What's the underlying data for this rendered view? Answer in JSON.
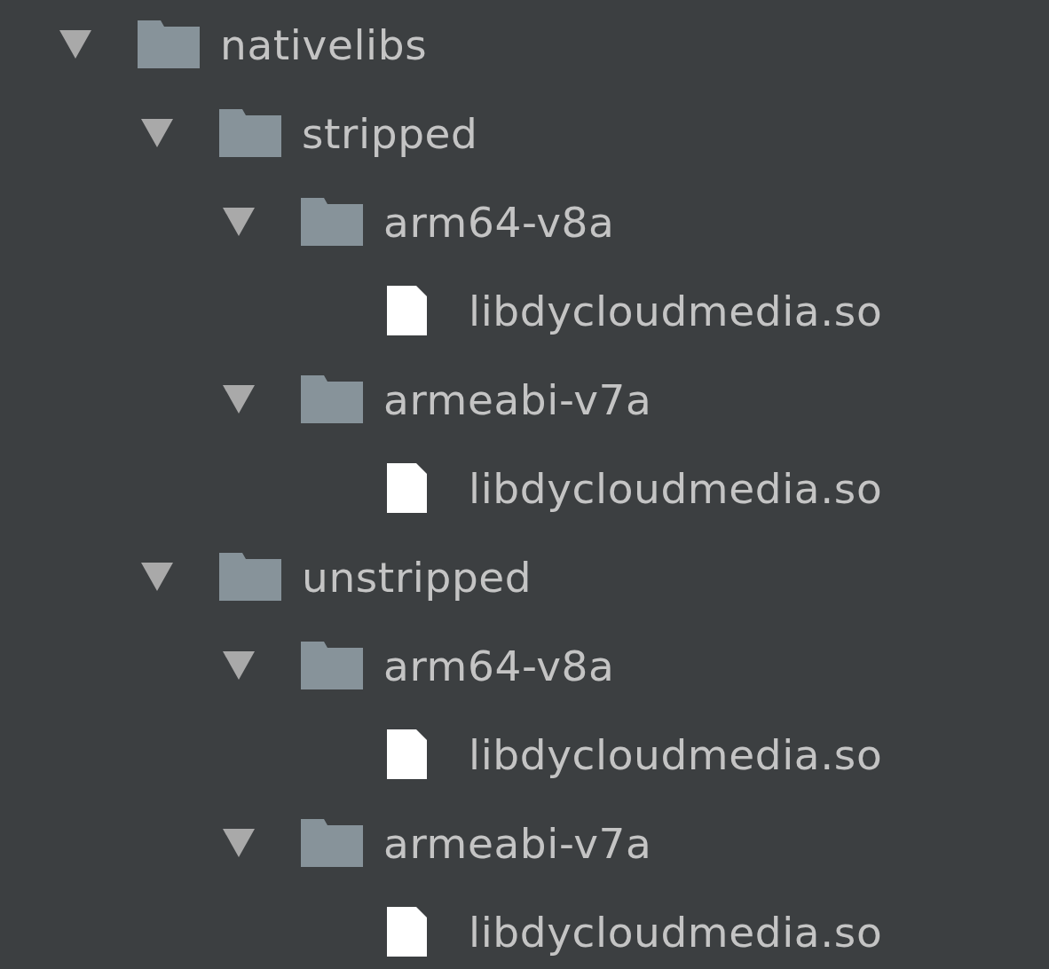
{
  "tree": [
    {
      "name": "nativelibs",
      "kind": "folder",
      "expanded": true,
      "children": [
        {
          "name": "stripped",
          "kind": "folder",
          "expanded": true,
          "children": [
            {
              "name": "arm64-v8a",
              "kind": "folder",
              "expanded": true,
              "children": [
                {
                  "name": "libdycloudmedia.so",
                  "kind": "file"
                }
              ]
            },
            {
              "name": "armeabi-v7a",
              "kind": "folder",
              "expanded": true,
              "children": [
                {
                  "name": "libdycloudmedia.so",
                  "kind": "file"
                }
              ]
            }
          ]
        },
        {
          "name": "unstripped",
          "kind": "folder",
          "expanded": true,
          "children": [
            {
              "name": "arm64-v8a",
              "kind": "folder",
              "expanded": true,
              "children": [
                {
                  "name": "libdycloudmedia.so",
                  "kind": "file"
                }
              ]
            },
            {
              "name": "armeabi-v7a",
              "kind": "folder",
              "expanded": true,
              "children": [
                {
                  "name": "libdycloudmedia.so",
                  "kind": "file"
                }
              ]
            }
          ]
        }
      ]
    }
  ]
}
